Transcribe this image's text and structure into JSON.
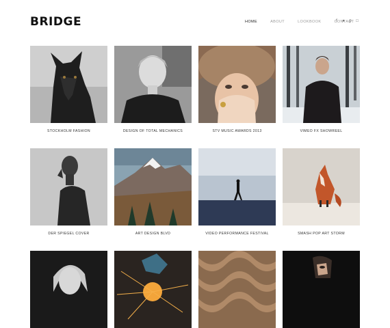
{
  "header": {
    "logo": "BRIDGE",
    "nav": [
      "HOME",
      "ABOUT",
      "LOOKBOOK",
      "CONTACT"
    ],
    "active_nav": "HOME",
    "social_icons": [
      "facebook-icon",
      "twitter-icon",
      "pinterest-icon",
      "instagram-icon"
    ]
  },
  "portfolio": [
    {
      "title": "STOCKHOLM FASHION",
      "subject": "black wolf"
    },
    {
      "title": "DESIGN OF TOTAL MECHANICS",
      "subject": "woman in black sweater"
    },
    {
      "title": "STV MUSIC AWARDS 2013",
      "subject": "woman in fur hat covering face"
    },
    {
      "title": "VIMEO FX SHOWREEL",
      "subject": "man in snowy forest"
    },
    {
      "title": "DER SPIEGEL COVER",
      "subject": "man profile portrait"
    },
    {
      "title": "ART DESIGN BLVD",
      "subject": "snowy mountain landscape"
    },
    {
      "title": "VIDEO PERFORMANCE FESTIVAL",
      "subject": "person walking on horizon"
    },
    {
      "title": "SMASH POP ART STORM",
      "subject": "red fox"
    },
    {
      "title": "",
      "subject": "woman portrait"
    },
    {
      "title": "",
      "subject": "welder with sparks"
    },
    {
      "title": "",
      "subject": "wavy wood texture"
    },
    {
      "title": "",
      "subject": "face in shadow"
    }
  ],
  "colors": {
    "background": "#ffffff",
    "active_nav": "#222222",
    "nav": "#9a9a9a"
  }
}
